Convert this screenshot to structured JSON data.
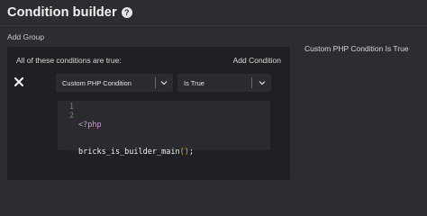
{
  "header": {
    "title": "Condition builder",
    "help_icon": "question-circle-icon"
  },
  "add_group_label": "Add Group",
  "group": {
    "description": "All of these conditions are true:",
    "add_condition_label": "Add Condition",
    "remove_icon": "close-icon",
    "condition": {
      "type_value": "Custom PHP Condition",
      "operator_value": "Is True",
      "code": {
        "line_numbers": [
          "1",
          "2"
        ],
        "line1": "<?php",
        "line2_func": "bricks_is_builder_main",
        "line2_parens": "()",
        "line2_semicolon": ";"
      }
    }
  },
  "side_label": "Custom PHP Condition Is True",
  "colors": {
    "background": "#2c2d30",
    "panel": "#1f2023",
    "input": "#2b2c30",
    "code_tag": "#cc99cd",
    "code_paren": "#e3a94a"
  }
}
